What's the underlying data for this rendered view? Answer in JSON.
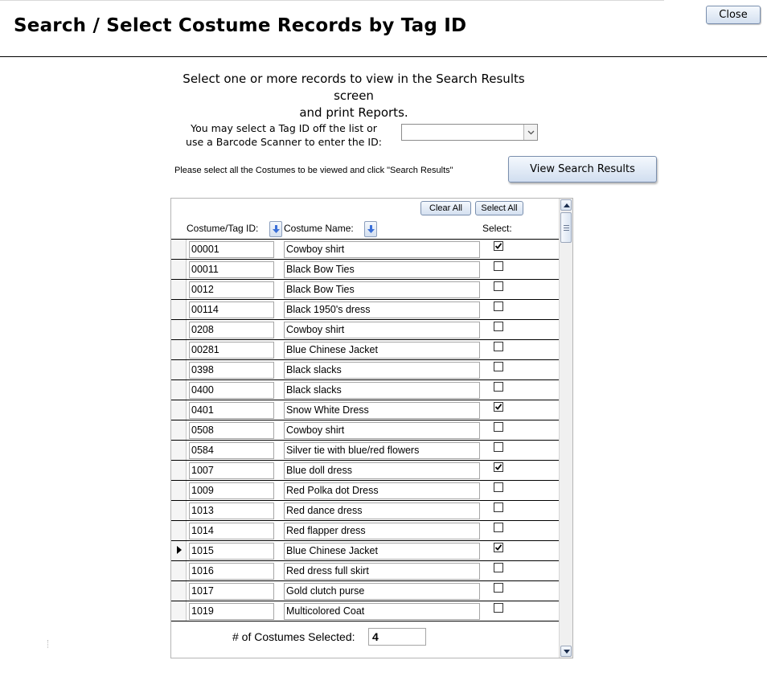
{
  "header": {
    "title": "Search / Select Costume Records by Tag ID",
    "close_label": "Close"
  },
  "instructions": {
    "line1": "Select one or more records to view in the Search Results screen",
    "line2": "and print Reports."
  },
  "tag_select": {
    "label_line1": "You may select a Tag ID off the list or",
    "label_line2": "use a Barcode Scanner to enter the ID:",
    "value": ""
  },
  "note": "Please select all the Costumes to be viewed and click \"Search Results\"",
  "view_button_label": "View Search Results",
  "list": {
    "clear_all_label": "Clear All",
    "select_all_label": "Select All",
    "col_tag_id": "Costume/Tag ID:",
    "col_name": "Costume Name:",
    "col_select": "Select:",
    "current_row_index": 15,
    "rows": [
      {
        "id": "00001",
        "name": "Cowboy shirt",
        "selected": true
      },
      {
        "id": "00011",
        "name": "Black Bow Ties",
        "selected": false
      },
      {
        "id": "0012",
        "name": "Black Bow Ties",
        "selected": false
      },
      {
        "id": "00114",
        "name": "Black 1950's dress",
        "selected": false
      },
      {
        "id": "0208",
        "name": "Cowboy shirt",
        "selected": false
      },
      {
        "id": "00281",
        "name": "Blue Chinese Jacket",
        "selected": false
      },
      {
        "id": "0398",
        "name": "Black slacks",
        "selected": false
      },
      {
        "id": "0400",
        "name": "Black slacks",
        "selected": false
      },
      {
        "id": "0401",
        "name": "Snow White Dress",
        "selected": true
      },
      {
        "id": "0508",
        "name": "Cowboy shirt",
        "selected": false
      },
      {
        "id": "0584",
        "name": "Silver tie with blue/red flowers",
        "selected": false
      },
      {
        "id": "1007",
        "name": "Blue doll dress",
        "selected": true
      },
      {
        "id": "1009",
        "name": "Red Polka dot Dress",
        "selected": false
      },
      {
        "id": "1013",
        "name": "Red dance dress",
        "selected": false
      },
      {
        "id": "1014",
        "name": "Red flapper dress",
        "selected": false
      },
      {
        "id": "1015",
        "name": "Blue Chinese Jacket",
        "selected": true
      },
      {
        "id": "1016",
        "name": "Red dress full skirt",
        "selected": false
      },
      {
        "id": "1017",
        "name": "Gold clutch purse",
        "selected": false
      },
      {
        "id": "1019",
        "name": "Multicolored Coat",
        "selected": false
      }
    ],
    "count_label": "# of Costumes Selected:",
    "count_value": "4"
  },
  "icons": {
    "sort": "sort-down-icon",
    "dropdown": "chevron-down-icon",
    "check": "checkmark-icon"
  },
  "colors": {
    "button_border": "#7a8fae",
    "button_top": "#f4f8fd",
    "button_bottom": "#d4e0f0",
    "sort_arrow": "#3a6fd8"
  }
}
